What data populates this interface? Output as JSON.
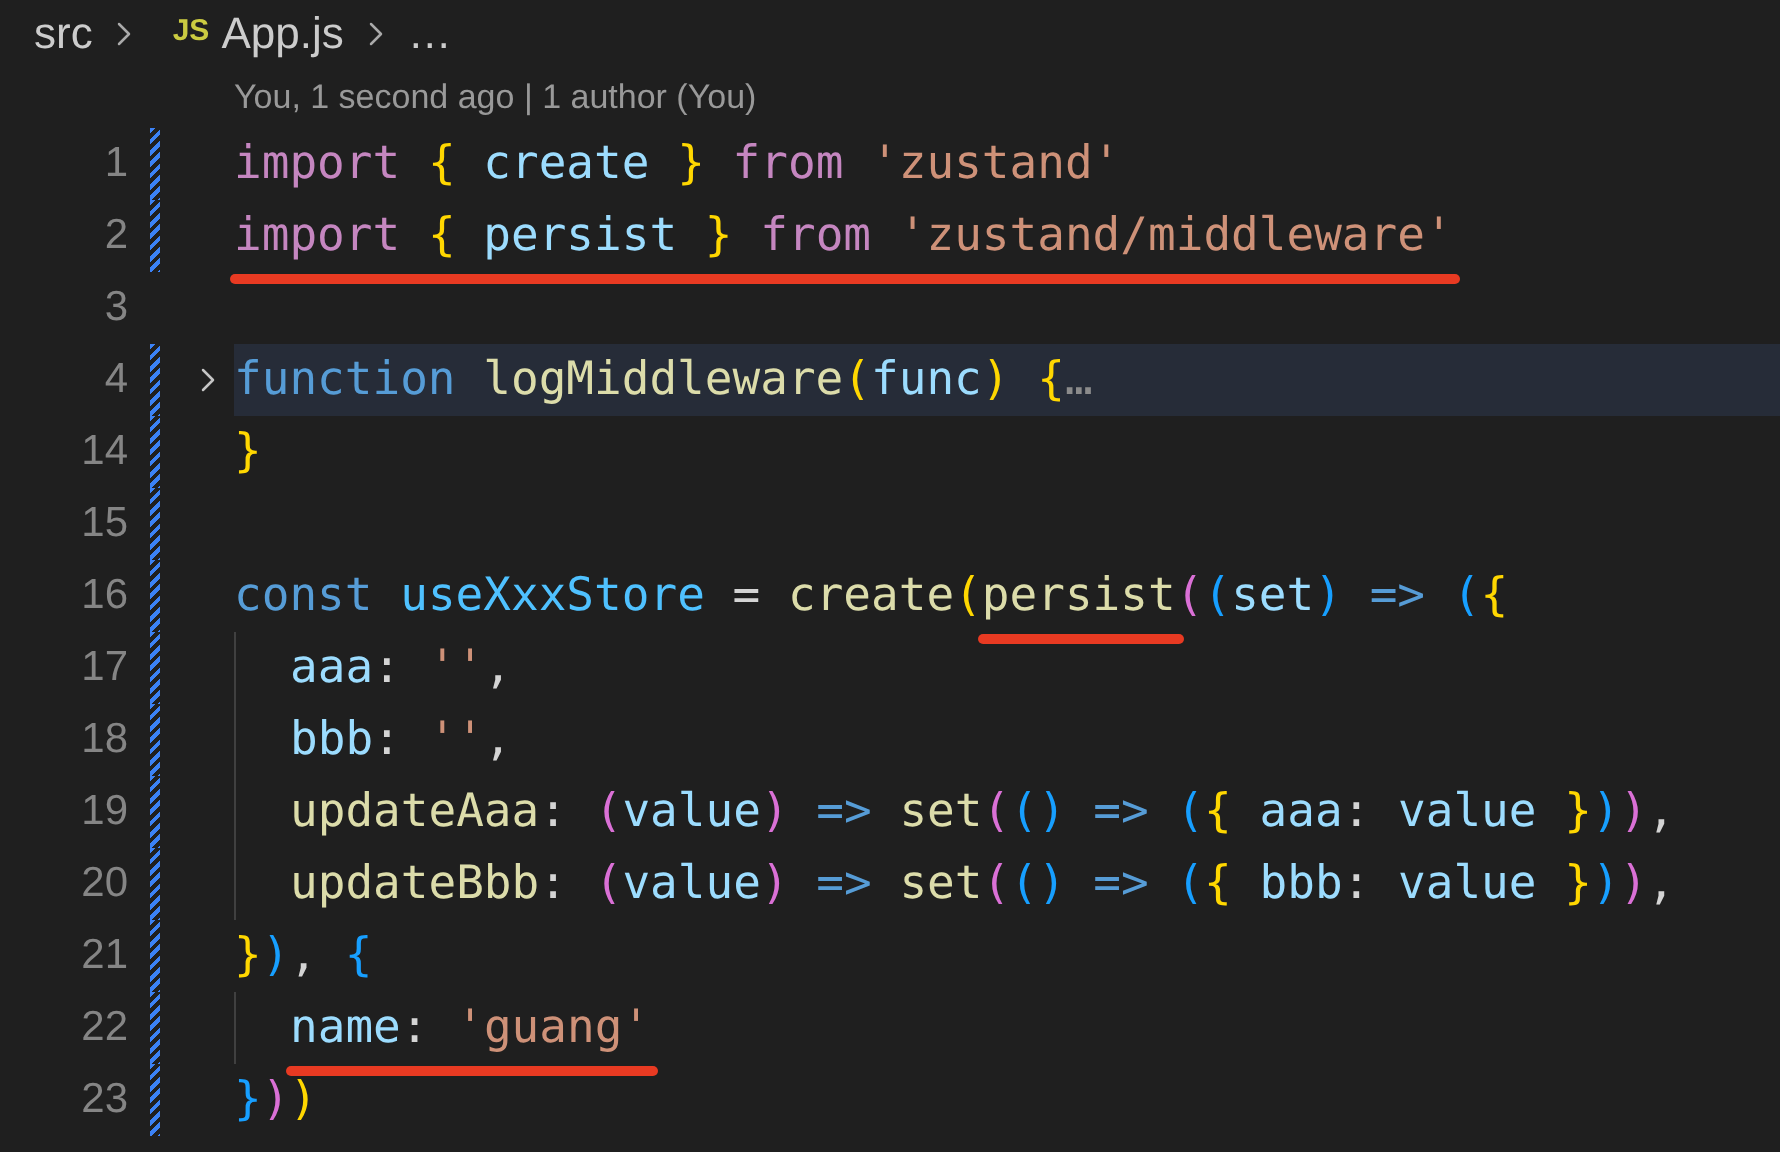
{
  "breadcrumb": {
    "folder": "src",
    "file_badge": "JS",
    "file": "App.js",
    "more": "…"
  },
  "codelens": "You, 1 second ago | 1 author (You)",
  "lines": [
    {
      "kind": "code",
      "number": "1",
      "modified": true,
      "tokens": [
        {
          "kind": "kw",
          "text": "import "
        },
        {
          "kind": "brace",
          "text": "{"
        },
        {
          "kind": "var",
          "text": " create "
        },
        {
          "kind": "brace",
          "text": "}"
        },
        {
          "kind": "kw",
          "text": " from "
        },
        {
          "kind": "str",
          "text": "'zustand'"
        }
      ]
    },
    {
      "kind": "code",
      "number": "2",
      "modified": true,
      "tokens": [
        {
          "kind": "kw",
          "text": "import ",
          "marked": true
        },
        {
          "kind": "brace",
          "text": "{",
          "marked": true
        },
        {
          "kind": "var",
          "text": " persist ",
          "marked": true
        },
        {
          "kind": "brace",
          "text": "}",
          "marked": true
        },
        {
          "kind": "kw",
          "text": " from ",
          "marked": true
        },
        {
          "kind": "str",
          "text": "'zustand/middleware'",
          "marked": true
        }
      ]
    },
    {
      "kind": "code",
      "number": "3",
      "modified": false
    },
    {
      "kind": "folded",
      "number": "4",
      "modified": true,
      "tokens": [
        {
          "kind": "storage",
          "text": "function "
        },
        {
          "kind": "fn",
          "text": "logMiddleware"
        },
        {
          "kind": "brace",
          "text": "("
        },
        {
          "kind": "var",
          "text": "func"
        },
        {
          "kind": "brace",
          "text": ")"
        },
        {
          "kind": "brace",
          "text": " {"
        },
        {
          "kind": "fold",
          "text": "…"
        }
      ]
    },
    {
      "kind": "code",
      "number": "14",
      "modified": true,
      "tokens": [
        {
          "kind": "brace",
          "text": "}"
        }
      ]
    },
    {
      "kind": "code",
      "number": "15",
      "modified": true
    },
    {
      "kind": "code",
      "number": "16",
      "modified": true,
      "tokens": [
        {
          "kind": "storage",
          "text": "const "
        },
        {
          "kind": "const",
          "text": "useXxxStore"
        },
        {
          "kind": "plain",
          "text": " = "
        },
        {
          "kind": "fn",
          "text": "create"
        },
        {
          "kind": "brace",
          "text": "("
        },
        {
          "kind": "fn",
          "text": "persist",
          "marked": true
        },
        {
          "kind": "p2",
          "text": "("
        },
        {
          "kind": "p3",
          "text": "("
        },
        {
          "kind": "var",
          "text": "set"
        },
        {
          "kind": "p3",
          "text": ")"
        },
        {
          "kind": "storage",
          "text": " => "
        },
        {
          "kind": "p3",
          "text": "("
        },
        {
          "kind": "brace",
          "text": "{"
        }
      ],
      "children": [
        {
          "kind": "code",
          "number": "17",
          "modified": true,
          "tokens": [
            {
              "kind": "var",
              "text": "aaa"
            },
            {
              "kind": "plain",
              "text": ": "
            },
            {
              "kind": "str",
              "text": "''"
            },
            {
              "kind": "plain",
              "text": ","
            }
          ]
        },
        {
          "kind": "code",
          "number": "18",
          "modified": true,
          "tokens": [
            {
              "kind": "var",
              "text": "bbb"
            },
            {
              "kind": "plain",
              "text": ": "
            },
            {
              "kind": "str",
              "text": "''"
            },
            {
              "kind": "plain",
              "text": ","
            }
          ]
        },
        {
          "kind": "code",
          "number": "19",
          "modified": true,
          "tokens": [
            {
              "kind": "fn",
              "text": "updateAaa"
            },
            {
              "kind": "plain",
              "text": ": "
            },
            {
              "kind": "p2",
              "text": "("
            },
            {
              "kind": "var",
              "text": "value"
            },
            {
              "kind": "p2",
              "text": ")"
            },
            {
              "kind": "storage",
              "text": " => "
            },
            {
              "kind": "fn",
              "text": "set"
            },
            {
              "kind": "p2",
              "text": "("
            },
            {
              "kind": "p3",
              "text": "()"
            },
            {
              "kind": "storage",
              "text": " => "
            },
            {
              "kind": "p3",
              "text": "("
            },
            {
              "kind": "brace",
              "text": "{"
            },
            {
              "kind": "var",
              "text": " aaa"
            },
            {
              "kind": "plain",
              "text": ": "
            },
            {
              "kind": "var",
              "text": "value "
            },
            {
              "kind": "brace",
              "text": "}"
            },
            {
              "kind": "p3",
              "text": ")"
            },
            {
              "kind": "p2",
              "text": ")"
            },
            {
              "kind": "plain",
              "text": ","
            }
          ]
        },
        {
          "kind": "code",
          "number": "20",
          "modified": true,
          "tokens": [
            {
              "kind": "fn",
              "text": "updateBbb"
            },
            {
              "kind": "plain",
              "text": ": "
            },
            {
              "kind": "p2",
              "text": "("
            },
            {
              "kind": "var",
              "text": "value"
            },
            {
              "kind": "p2",
              "text": ")"
            },
            {
              "kind": "storage",
              "text": " => "
            },
            {
              "kind": "fn",
              "text": "set"
            },
            {
              "kind": "p2",
              "text": "("
            },
            {
              "kind": "p3",
              "text": "()"
            },
            {
              "kind": "storage",
              "text": " => "
            },
            {
              "kind": "p3",
              "text": "("
            },
            {
              "kind": "brace",
              "text": "{"
            },
            {
              "kind": "var",
              "text": " bbb"
            },
            {
              "kind": "plain",
              "text": ": "
            },
            {
              "kind": "var",
              "text": "value "
            },
            {
              "kind": "brace",
              "text": "}"
            },
            {
              "kind": "p3",
              "text": ")"
            },
            {
              "kind": "p2",
              "text": ")"
            },
            {
              "kind": "plain",
              "text": ","
            }
          ]
        }
      ]
    },
    {
      "kind": "code",
      "number": "21",
      "modified": true,
      "tokens": [
        {
          "kind": "brace",
          "text": "}"
        },
        {
          "kind": "p3",
          "text": ")"
        },
        {
          "kind": "plain",
          "text": ", "
        },
        {
          "kind": "p3",
          "text": "{"
        }
      ],
      "children": [
        {
          "kind": "code",
          "number": "22",
          "modified": true,
          "tokens": [
            {
              "kind": "var",
              "text": "name",
              "marked": true
            },
            {
              "kind": "plain",
              "text": ": ",
              "marked": true
            },
            {
              "kind": "str",
              "text": "'guang'",
              "marked": true
            }
          ]
        }
      ]
    },
    {
      "kind": "code",
      "number": "23",
      "modified": true,
      "tokens": [
        {
          "kind": "p3",
          "text": "}"
        },
        {
          "kind": "p2",
          "text": ")"
        },
        {
          "kind": "brace",
          "text": ")"
        }
      ]
    }
  ]
}
